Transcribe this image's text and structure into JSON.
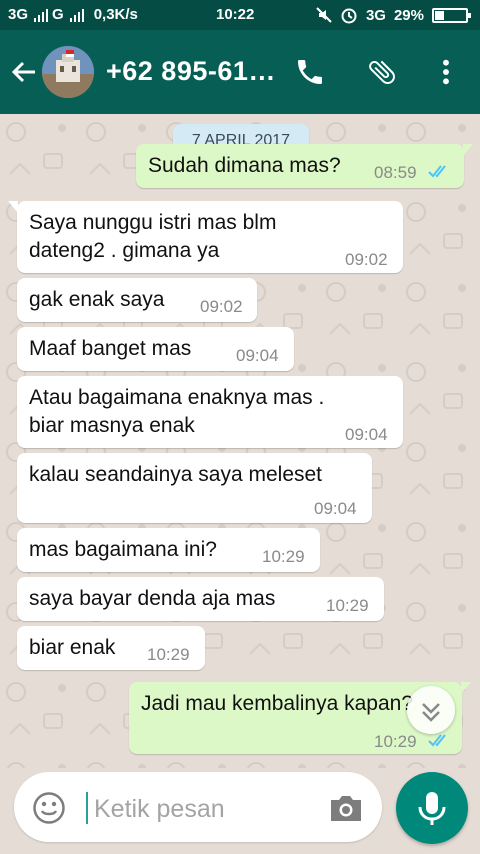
{
  "status_bar": {
    "network_left": "3G",
    "network_mid": "G",
    "speed": "0,3K/s",
    "time": "10:22",
    "network_right": "3G",
    "battery_text": "29%",
    "battery_level": 0.29
  },
  "header": {
    "title": "+62 895-61…",
    "back_icon": "arrow-left-icon",
    "call_icon": "phone-icon",
    "attach_icon": "paperclip-icon",
    "menu_icon": "more-vert-icon",
    "color": "#075e54"
  },
  "chat": {
    "date_chip": "7 APRIL 2017",
    "messages": [
      {
        "dir": "out",
        "lines": [
          "Sudah dimana mas?"
        ],
        "time": "08:59",
        "read": true
      },
      {
        "dir": "in",
        "lines": [
          "Saya nunggu istri mas blm",
          "dateng2 . gimana ya"
        ],
        "time": "09:02"
      },
      {
        "dir": "in",
        "lines": [
          "gak enak saya"
        ],
        "time": "09:02"
      },
      {
        "dir": "in",
        "lines": [
          "Maaf banget mas"
        ],
        "time": "09:04"
      },
      {
        "dir": "in",
        "lines": [
          "Atau bagaimana enaknya mas .",
          "biar masnya enak"
        ],
        "time": "09:04"
      },
      {
        "dir": "in",
        "lines": [
          "kalau seandainya saya meleset"
        ],
        "time": "09:04"
      },
      {
        "dir": "in",
        "lines": [
          "mas bagaimana ini?"
        ],
        "time": "10:29"
      },
      {
        "dir": "in",
        "lines": [
          "saya bayar denda aja mas"
        ],
        "time": "10:29"
      },
      {
        "dir": "in",
        "lines": [
          "biar enak"
        ],
        "time": "10:29"
      },
      {
        "dir": "out",
        "lines": [
          "Jadi mau kembalinya kapan?"
        ],
        "time": "10:29",
        "read": true
      }
    ]
  },
  "input": {
    "placeholder": "Ketik pesan",
    "emoji_icon": "emoji-icon",
    "camera_icon": "camera-icon",
    "mic_icon": "mic-icon"
  },
  "colors": {
    "status_bar": "#054d44",
    "header": "#075e54",
    "outgoing_bubble": "#dcf8c6",
    "incoming_bubble": "#ffffff",
    "read_ticks": "#4fc3f7",
    "mic_button": "#00897b"
  }
}
